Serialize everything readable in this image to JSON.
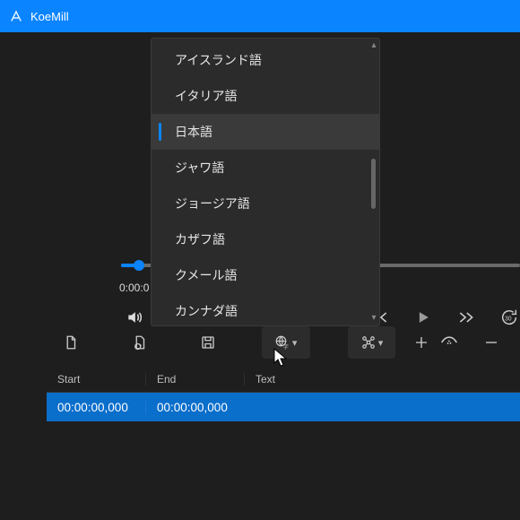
{
  "app": {
    "title": "KoeMill"
  },
  "player": {
    "time_current": "0:00:0"
  },
  "language_dropdown": {
    "options": [
      {
        "label": "アイスランド語",
        "selected": false
      },
      {
        "label": "イタリア語",
        "selected": false
      },
      {
        "label": "日本語",
        "selected": true
      },
      {
        "label": "ジャワ語",
        "selected": false
      },
      {
        "label": "ジョージア語",
        "selected": false
      },
      {
        "label": "カザフ語",
        "selected": false
      },
      {
        "label": "クメール語",
        "selected": false
      },
      {
        "label": "カンナダ語",
        "selected": false
      }
    ]
  },
  "table": {
    "columns": {
      "start": "Start",
      "end": "End",
      "text": "Text"
    },
    "rows": [
      {
        "start": "00:00:00,000",
        "end": "00:00:00,000",
        "text": ""
      }
    ]
  },
  "colors": {
    "accent": "#0a84ff",
    "row_selected": "#0a6ecb"
  }
}
